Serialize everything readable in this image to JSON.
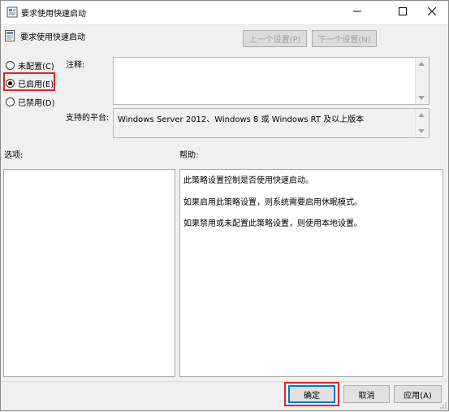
{
  "window": {
    "title": "要求使用快速启动"
  },
  "header": {
    "title": "要求使用快速启动",
    "prev_setting": "上一个设置(P)",
    "next_setting": "下一个设置(N)"
  },
  "state": {
    "options": [
      {
        "label": "未配置(C)",
        "selected": false
      },
      {
        "label": "已启用(E)",
        "selected": true
      },
      {
        "label": "已禁用(D)",
        "selected": false
      }
    ]
  },
  "comment": {
    "label": "注释:",
    "value": ""
  },
  "platform": {
    "label": "支持的平台:",
    "value": "Windows Server 2012、Windows 8 或 Windows RT 及以上版本"
  },
  "options_label": "选项:",
  "help": {
    "label": "帮助:",
    "lines": [
      "此策略设置控制是否使用快速启动。",
      "如果启用此策略设置，则系统需要启用休眠模式。",
      "如果禁用或未配置此策略设置，则使用本地设置。"
    ]
  },
  "buttons": {
    "ok": "确定",
    "cancel": "取消",
    "apply": "应用(A)"
  },
  "colors": {
    "highlight": "#d9262c",
    "focus": "#0078d7"
  }
}
